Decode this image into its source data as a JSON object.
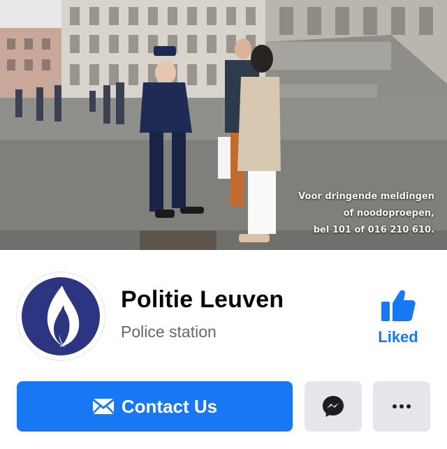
{
  "cover": {
    "caption_lines": [
      "Voor dringende meldingen",
      "of noodoproepen,",
      "bel 101 of 016 210 610."
    ]
  },
  "page": {
    "name": "Politie Leuven",
    "category": "Police station"
  },
  "like_status": {
    "label": "Liked",
    "icon": "thumbs-up-icon",
    "color": "#1877f2"
  },
  "actions": {
    "contact_label": "Contact Us",
    "contact_icon": "envelope-icon",
    "messenger_icon": "messenger-icon",
    "more_icon": "more-dots-icon"
  },
  "colors": {
    "primary": "#1877f2",
    "secondary_button": "#e4e6eb",
    "police_blue": "#2b3582",
    "text_secondary": "#65676b"
  }
}
